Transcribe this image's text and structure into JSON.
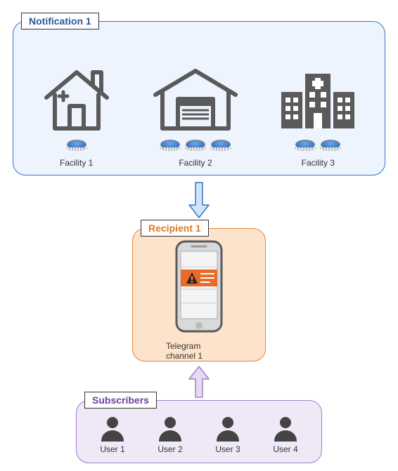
{
  "notification": {
    "label": "Notification 1",
    "facilities": [
      {
        "name": "Facility 1",
        "sensors": 1
      },
      {
        "name": "Facility 2",
        "sensors": 3
      },
      {
        "name": "Facility 3",
        "sensors": 2
      }
    ]
  },
  "recipient": {
    "label": "Recipient 1",
    "channel": "Telegram channel 1"
  },
  "subscribers": {
    "label": "Subscribers",
    "users": [
      "User 1",
      "User 2",
      "User 3",
      "User 4"
    ]
  },
  "colors": {
    "notification_border": "#3773c8",
    "recipient_border": "#e08731",
    "subscribers_border": "#a17fc8",
    "icon_gray": "#5a5a5a",
    "arrow_blue_fill": "#cfe3fb",
    "arrow_blue_stroke": "#3773c8",
    "arrow_purple_fill": "#e4daf1",
    "arrow_purple_stroke": "#a17fc8",
    "alert_band": "#e86b2a"
  }
}
